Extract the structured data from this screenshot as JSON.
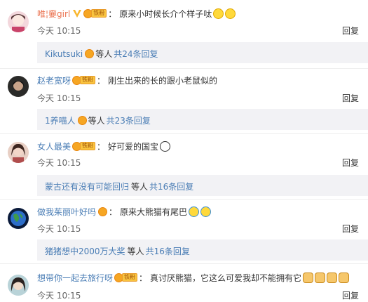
{
  "comments": [
    {
      "username": "唯¦嫑girl",
      "fan_tag": "铁粉",
      "text": "原来小时候长介个样子呔",
      "time": "今天 10:15",
      "reply_label": "回复",
      "reply_summary": {
        "name": "Kikutsuki",
        "mid": "等人",
        "count": "共24条回复"
      }
    },
    {
      "username": "赵老宽呀",
      "fan_tag": "铁粉",
      "text": "刚生出来的长的跟小老鼠似的",
      "time": "今天 10:15",
      "reply_label": "回复",
      "reply_summary": {
        "name": "1养喵人",
        "mid": "等人",
        "count": "共23条回复"
      }
    },
    {
      "username": "女人最美",
      "fan_tag": "铁粉",
      "text": "好可爱的国宝",
      "time": "今天 10:15",
      "reply_label": "回复",
      "reply_summary": {
        "name": "蒙古还有没有可能回归",
        "mid": "等人",
        "count": "共16条回复"
      }
    },
    {
      "username": "做我茱丽叶好吗",
      "fan_tag": "",
      "text": "原来大熊猫有尾巴",
      "time": "今天 10:15",
      "reply_label": "回复",
      "reply_summary": {
        "name": "猪猪想中2000万大奖",
        "mid": "等人",
        "count": "共16条回复"
      }
    },
    {
      "username": "想带你一起去旅行呀",
      "fan_tag": "铁粉",
      "text": "真讨厌熊猫，它这么可爱我却不能拥有它",
      "time": "今天 10:15",
      "reply_label": "回复"
    }
  ],
  "colon": "：",
  "colors": {
    "accent_orange": "#eb7350",
    "link_blue": "#4a7db5",
    "reply_bg": "#f2f2f5",
    "fan_badge": "#f9c440"
  }
}
